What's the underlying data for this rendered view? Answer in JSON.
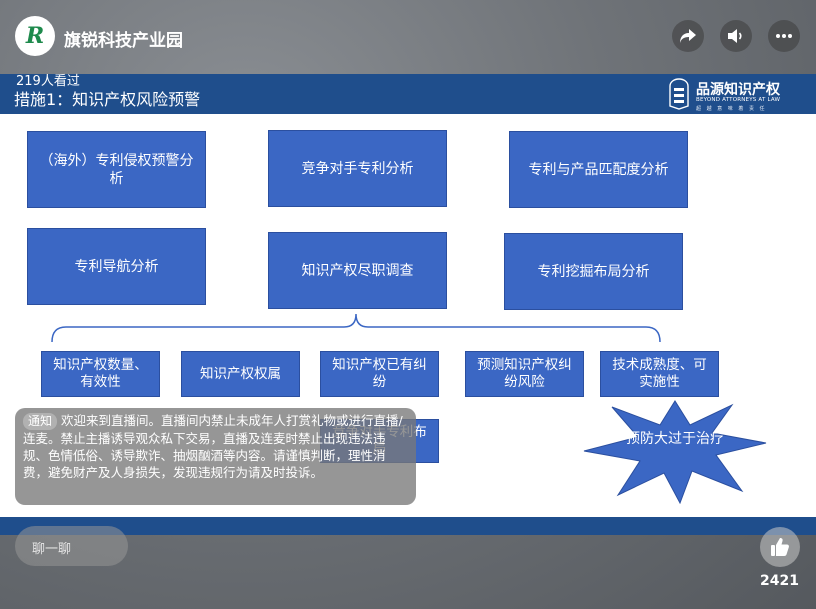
{
  "app": {
    "channel_name": "旗锐科技产业园",
    "viewers": "219人看过"
  },
  "slide": {
    "title": "措施1：知识产权风险预警",
    "brand": {
      "name": "品源知识产权",
      "english": "BEYOND ATTORNEYS AT LAW",
      "tagline": "超 越 意 味 着 责 任"
    },
    "row1": [
      "（海外）专利侵权预警分析",
      "竞争对手专利分析",
      "专利与产品匹配度分析"
    ],
    "row2": [
      "专利导航分析",
      "知识产权尽职调查",
      "专利挖掘布局分析"
    ],
    "row3": [
      "知识产权数量、有效性",
      "知识产权权属",
      "知识产权已有纠纷",
      "预测知识产权纠纷风险",
      "技术成熟度、可实施性"
    ],
    "partial_box": "竞争对手专利布局",
    "star_text": "预防大过于治疗"
  },
  "notice": {
    "tag": "通知",
    "text": "欢迎来到直播间。直播间内禁止未成年人打赏礼物或进行直播/连麦。禁止主播诱导观众私下交易，直播及连麦时禁止出现违法违规、色情低俗、诱导欺诈、抽烟酗酒等内容。请谨慎判断，理性消费，避免财产及人身损失，发现违规行为请及时投诉。"
  },
  "chat": {
    "placeholder": "聊一聊"
  },
  "likes": {
    "count": "2421"
  },
  "colors": {
    "header_blue": "#1f4e8c",
    "box_blue": "#3b67c4"
  },
  "icons": [
    "share-icon",
    "volume-icon",
    "more-icon",
    "thumbs-up-icon"
  ]
}
